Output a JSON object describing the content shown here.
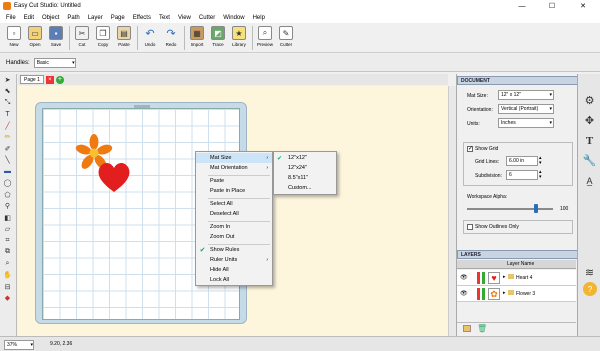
{
  "window": {
    "title": "Easy Cut Studio: Untitled",
    "min": "—",
    "max": "☐",
    "close": "✕"
  },
  "menu": [
    "File",
    "Edit",
    "Object",
    "Path",
    "Layer",
    "Page",
    "Effects",
    "Text",
    "View",
    "Cutter",
    "Window",
    "Help"
  ],
  "toolbar": {
    "new": "New",
    "open": "Open",
    "save": "Save",
    "cut": "Cut",
    "copy": "Copy",
    "paste": "Paste",
    "undo": "Undo",
    "redo": "Redo",
    "import": "Import",
    "trace": "Trace",
    "library": "Library",
    "preview": "Preview",
    "cutter": "Cutter"
  },
  "propbar": {
    "handles_label": "Handles:",
    "handles_value": "Basic"
  },
  "tabs": {
    "page1": "Page 1",
    "close": "×",
    "add": "+"
  },
  "context_menu": {
    "mat_size": "Mat Size",
    "mat_orientation": "Mat Orientation",
    "paste": "Paste",
    "paste_in_place": "Paste in Place",
    "select_all": "Select All",
    "deselect_all": "Deselect All",
    "zoom_in": "Zoom In",
    "zoom_out": "Zoom Out",
    "show_rules": "Show Rules",
    "ruler_units": "Ruler Units",
    "hide_all": "Hide All",
    "lock_all": "Lock All"
  },
  "submenu": [
    "12\"x12\"",
    "12\"x24\"",
    "8.5\"x11\"",
    "Custom..."
  ],
  "document": {
    "header": "DOCUMENT",
    "mat_size_label": "Mat Size:",
    "mat_size_value": "12\" x 12\"",
    "orientation_label": "Orientation:",
    "orientation_value": "Vertical (Portrait)",
    "units_label": "Units:",
    "units_value": "Inches",
    "show_grid": "Show Grid",
    "grid_lines_label": "Grid Lines:",
    "grid_lines_value": "6.00 in",
    "subdivision_label": "Subdivision:",
    "subdivision_value": "6",
    "workspace_alpha_label": "Workspace Alpha:",
    "workspace_alpha_value": "100",
    "workspace_alpha_level": 0.8,
    "show_outlines": "Show Outlines Only"
  },
  "layers": {
    "header": "LAYERS",
    "col_name": "Layer Name",
    "items": [
      {
        "name": "Heart 4",
        "color": "#e31e1e"
      },
      {
        "name": "Flower 3",
        "color": "#f07a12"
      }
    ]
  },
  "status": {
    "zoom": "37%",
    "coords": "9.20, 2.36"
  },
  "colors": {
    "heart": "#e31e1e",
    "flower": "#f07a12",
    "flower_center": "#f6c12d",
    "accent": "#cce4f7"
  }
}
